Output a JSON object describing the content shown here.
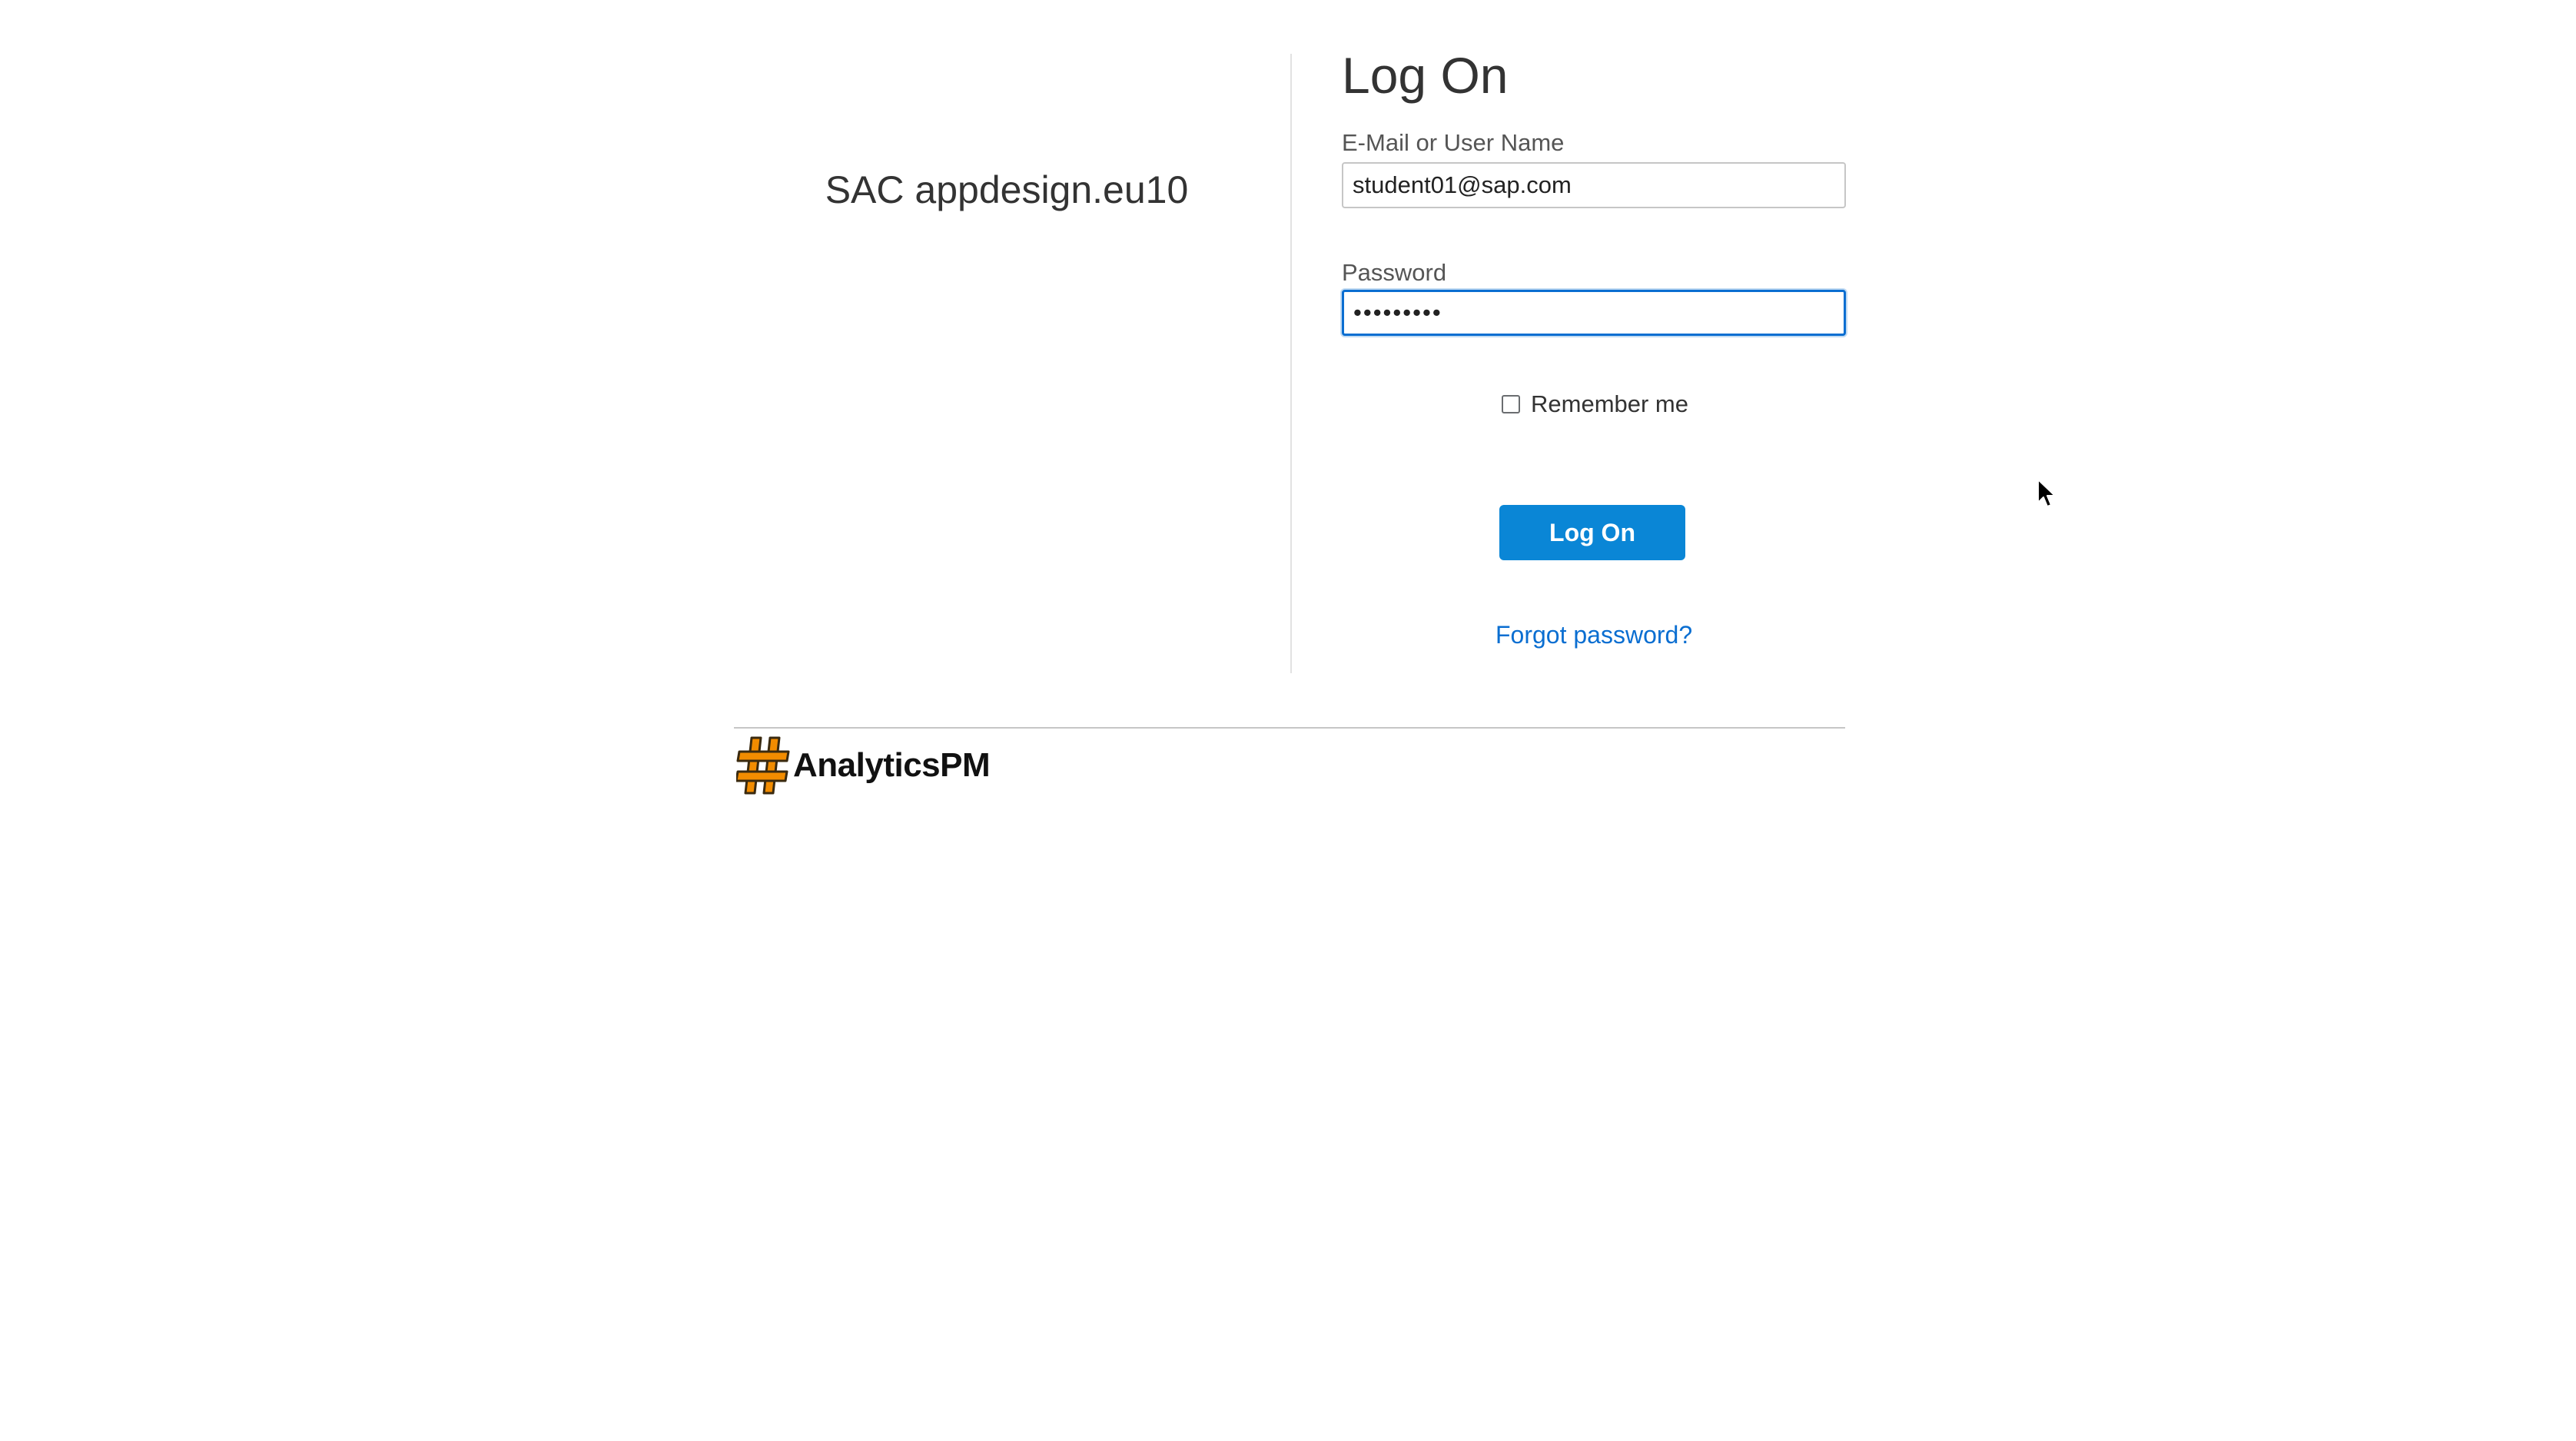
{
  "tenant": {
    "name": "SAC appdesign.eu10"
  },
  "form": {
    "title": "Log On",
    "username_label": "E-Mail or User Name",
    "username_value": "student01@sap.com",
    "password_label": "Password",
    "password_value": "•••••••••",
    "remember_label": "Remember me",
    "remember_checked": false,
    "logon_label": "Log On",
    "forgot_label": "Forgot password?"
  },
  "footer": {
    "logo_icon": "hashtag-icon",
    "logo_text": "AnalyticsPM"
  },
  "colors": {
    "accent": "#0a86d6",
    "link": "#0a6ed1",
    "logo_orange": "#f28c00"
  }
}
